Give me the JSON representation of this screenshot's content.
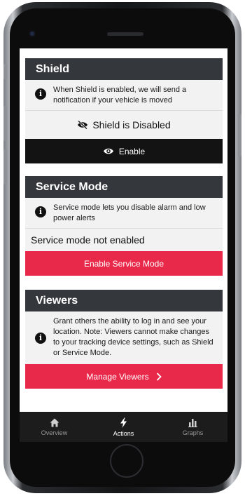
{
  "shield": {
    "title": "Shield",
    "info": "When Shield is enabled, we will send a notification if your vehicle is moved",
    "status": "Shield is Disabled",
    "button_label": "Enable"
  },
  "service_mode": {
    "title": "Service Mode",
    "info": "Service mode lets you disable alarm and low power alerts",
    "status": "Service mode not enabled",
    "button_label": "Enable Service Mode"
  },
  "viewers": {
    "title": "Viewers",
    "info": "Grant others the ability to log in and see your location. Note: Viewers cannot make changes to your tracking device settings, such as Shield or Service Mode.",
    "button_label": "Manage Viewers"
  },
  "tabbar": {
    "items": [
      {
        "label": "Overview",
        "icon": "home-icon",
        "active": false
      },
      {
        "label": "Actions",
        "icon": "lightning-icon",
        "active": true
      },
      {
        "label": "Graphs",
        "icon": "bar-chart-icon",
        "active": false
      }
    ]
  },
  "colors": {
    "header": "#34383c",
    "dark_button": "#131313",
    "accent_red": "#e8294a",
    "tabbar": "#1c1c1c"
  }
}
